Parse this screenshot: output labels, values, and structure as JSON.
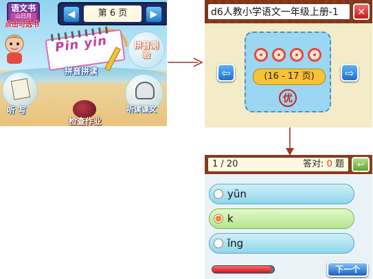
{
  "home_screen": {
    "textbook": {
      "title": "语文书",
      "subtitle": "山日月",
      "hint": "点击可选书"
    },
    "page_nav": {
      "prev_icon": "triangle-left",
      "next_icon": "triangle-right",
      "page_label": "第 6 页"
    },
    "pinyin": {
      "word": "Pin yin",
      "label": "拼音拼读"
    },
    "test_label": "拼音测验",
    "dictation_label": "听 写",
    "listen_label": "听读课文",
    "homework_label": "检查作业"
  },
  "unit_screen": {
    "book_title": "d6人教小学语文一年级上册-1",
    "close_icon": "close-x",
    "prev_icon": "arrow-left",
    "next_icon": "arrow-right",
    "range_label": "(16 - 17 页)",
    "grade_stamp": "优"
  },
  "quiz_screen": {
    "progress": "1 / 20",
    "answered_label": "答对:",
    "answered_count": "0",
    "answered_unit": "题",
    "back_icon": "return-arrow",
    "options": [
      {
        "text": "yūn",
        "selected": false
      },
      {
        "text": "k",
        "selected": true
      },
      {
        "text": "ǐng",
        "selected": false
      }
    ],
    "progress_fraction": 0.05,
    "next_label": "下一个"
  },
  "colors": {
    "arrow": "#a0322c",
    "accent_red": "#c9241d",
    "brown_bar": "#8a3a1e"
  }
}
